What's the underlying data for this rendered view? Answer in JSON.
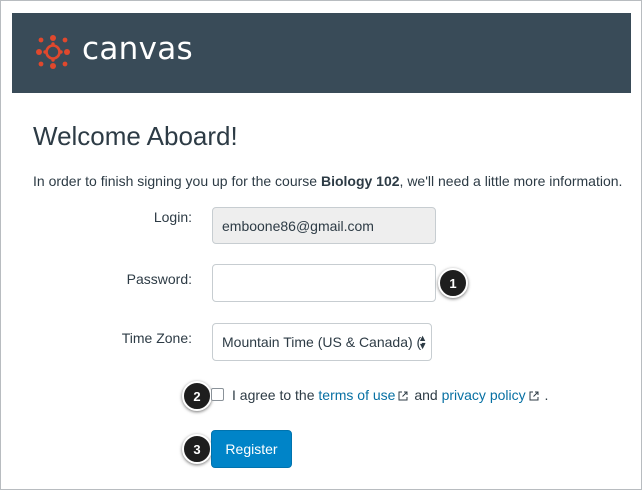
{
  "header": {
    "logo_text": "canvas",
    "logo_icon": "canvas-logo-icon"
  },
  "page": {
    "title": "Welcome Aboard!",
    "intro_before": "In order to finish signing you up for the course ",
    "course_name": "Biology 102",
    "intro_after": ", we'll need a little more information."
  },
  "form": {
    "login_label": "Login:",
    "login_value": "emboone86@gmail.com",
    "password_label": "Password:",
    "password_value": "",
    "timezone_label": "Time Zone:",
    "timezone_value": "Mountain Time (US & Canada) (-",
    "agree_text": "I agree to the",
    "terms_link": "terms of use",
    "and_text": "and",
    "privacy_link": "privacy policy",
    "period": ".",
    "external_icon": "external-link-icon",
    "register_label": "Register"
  },
  "callouts": {
    "one": "1",
    "two": "2",
    "three": "3"
  },
  "colors": {
    "header_bg": "#394b58",
    "logo_red": "#e0482d",
    "link": "#0770a3",
    "button": "#0084c8"
  }
}
